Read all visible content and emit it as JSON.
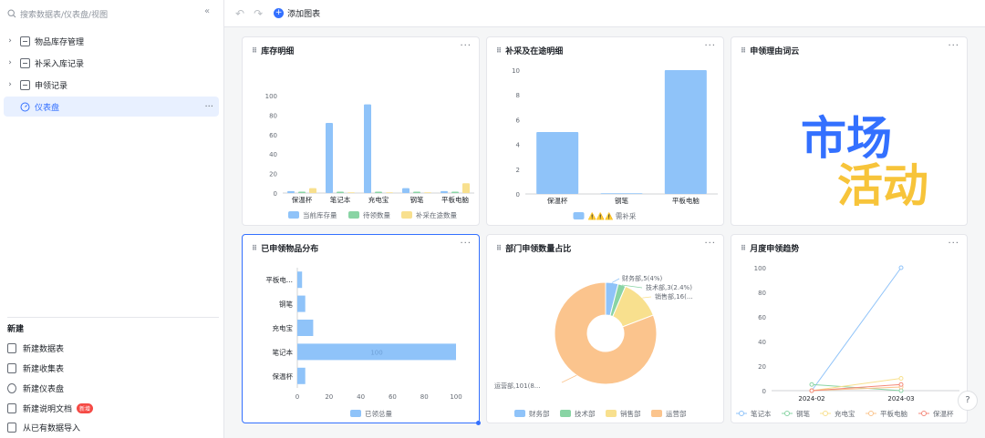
{
  "sidebar": {
    "search_placeholder": "搜索数据表/仪表盘/视图",
    "items": [
      {
        "label": "物品库存管理"
      },
      {
        "label": "补采入库记录"
      },
      {
        "label": "申领记录"
      },
      {
        "label": "仪表盘"
      }
    ],
    "new_section": {
      "title": "新建",
      "items": [
        {
          "label": "新建数据表"
        },
        {
          "label": "新建收集表"
        },
        {
          "label": "新建仪表盘"
        },
        {
          "label": "新建说明文档",
          "badge": "新增"
        },
        {
          "label": "从已有数据导入"
        }
      ]
    }
  },
  "toolbar": {
    "add_chart_label": "添加图表"
  },
  "colors": {
    "accent": "#3370ff",
    "blue": "#8fc3f9",
    "green": "#89d4a4",
    "yellow": "#f8e08e",
    "orange": "#fbc48d",
    "red": "#f48a7b",
    "pie_blue": "#8fc3f9"
  },
  "cards": {
    "inventory": {
      "title": "库存明细"
    },
    "restock": {
      "title": "补采及在途明细"
    },
    "wordcloud": {
      "title": "申领理由词云",
      "words": [
        "市场",
        "活动"
      ]
    },
    "distribution": {
      "title": "已申领物品分布"
    },
    "department": {
      "title": "部门申领数量占比"
    },
    "trend": {
      "title": "月度申领趋势"
    }
  },
  "chart_data": [
    {
      "id": "inventory",
      "type": "bar",
      "categories": [
        "保温杯",
        "笔记本",
        "充电宝",
        "钢笔",
        "平板电脑"
      ],
      "ylim": [
        0,
        100
      ],
      "yticks": [
        0,
        20,
        40,
        60,
        80,
        100
      ],
      "series": [
        {
          "name": "当前库存量",
          "values": [
            2,
            72,
            91,
            5,
            2
          ]
        },
        {
          "name": "待领数量",
          "values": [
            1,
            1,
            1,
            1,
            1
          ]
        },
        {
          "name": "补采在途数量",
          "values": [
            5,
            0,
            0,
            0,
            10
          ]
        }
      ],
      "legend": "bottom"
    },
    {
      "id": "restock",
      "type": "bar",
      "categories": [
        "保温杯",
        "钢笔",
        "平板电脑"
      ],
      "ylim": [
        0,
        10
      ],
      "yticks": [
        0,
        2,
        4,
        6,
        8,
        10
      ],
      "series": [
        {
          "name": "⚠️⚠️⚠️ 需补采",
          "values": [
            5,
            0,
            10
          ]
        }
      ],
      "legend": "bottom"
    },
    {
      "id": "distribution",
      "type": "bar",
      "orientation": "horizontal",
      "categories": [
        "平板电...",
        "钢笔",
        "充电宝",
        "笔记本",
        "保温杯"
      ],
      "xlim": [
        0,
        100
      ],
      "xticks": [
        0,
        20,
        40,
        60,
        80,
        100
      ],
      "series": [
        {
          "name": "已领总量",
          "values": [
            3,
            5,
            10,
            100,
            5
          ]
        }
      ],
      "data_labels": [
        "",
        "",
        "",
        "100",
        ""
      ],
      "legend": "bottom"
    },
    {
      "id": "department",
      "type": "pie",
      "donut": true,
      "slices": [
        {
          "name": "财务部",
          "value": 5,
          "label": "财务部,5(4%)"
        },
        {
          "name": "技术部",
          "value": 3,
          "label": "技术部,3(2.4%)"
        },
        {
          "name": "销售部",
          "value": 16,
          "label": "销售部,16(..."
        },
        {
          "name": "运营部",
          "value": 101,
          "label": "运营部,101(8..."
        }
      ],
      "legend": "bottom"
    },
    {
      "id": "trend",
      "type": "line",
      "x": [
        "2024-02",
        "2024-03"
      ],
      "ylim": [
        0,
        100
      ],
      "yticks": [
        0,
        20,
        40,
        60,
        80,
        100
      ],
      "series": [
        {
          "name": "笔记本",
          "values": [
            0,
            100
          ]
        },
        {
          "name": "钢笔",
          "values": [
            5,
            0
          ]
        },
        {
          "name": "充电宝",
          "values": [
            0,
            10
          ]
        },
        {
          "name": "平板电脑",
          "values": [
            0,
            3
          ]
        },
        {
          "name": "保温杯",
          "values": [
            0,
            5
          ]
        }
      ],
      "legend": "bottom"
    }
  ]
}
